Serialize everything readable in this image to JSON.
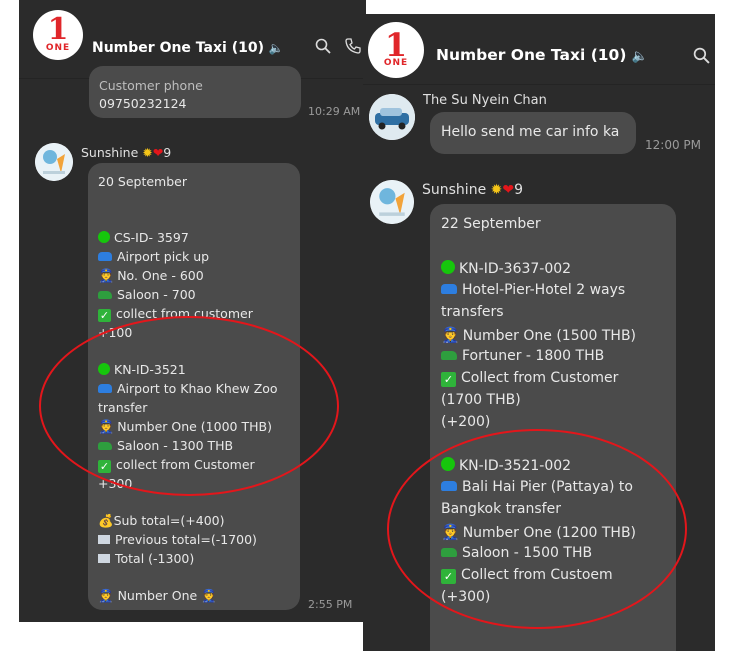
{
  "left": {
    "header": {
      "title": "Number One Taxi",
      "count": "(10)"
    },
    "logo": {
      "numeral": "1",
      "word": "ONE"
    },
    "prev_msg": {
      "lines": [
        "Customer phone",
        "09750232124"
      ],
      "time": "10:29 AM"
    },
    "sender": {
      "name": "Sunshine",
      "suffix": "9"
    },
    "msg": {
      "date": "20 September",
      "l1": "CS-ID- 3597",
      "l2": "Airport pick up",
      "l3": "No. One - 600",
      "l4": "Saloon - 700",
      "l5": "collect from customer",
      "l6": "+100",
      "l7": "KN-ID-3521",
      "l8": "Airport to Khao Khew Zoo",
      "l9": "transfer",
      "l10": "Number One (1000 THB)",
      "l11": "Saloon - 1300 THB",
      "l12": "collect from Customer",
      "l13": "+300",
      "l14": "Sub total=(+400)",
      "l15": "Previous total=(-1700)",
      "l16": "Total (-1300)",
      "l17": "Number One",
      "time": "2:55 PM"
    }
  },
  "right": {
    "header": {
      "title": "Number One Taxi",
      "count": "(10)"
    },
    "logo": {
      "numeral": "1",
      "word": "ONE"
    },
    "prev_sender": "The Su Nyein Chan",
    "prev_msg": {
      "text": "Hello send me car info ka",
      "time": "12:00 PM"
    },
    "sender": {
      "name": "Sunshine",
      "suffix": "9"
    },
    "msg": {
      "date": "22 September",
      "l1": "KN-ID-3637-002",
      "l2": "Hotel-Pier-Hotel 2 ways",
      "l3": "transfers",
      "l4": "Number One (1500 THB)",
      "l5": "Fortuner - 1800 THB",
      "l6": "Collect from Customer",
      "l7": "(1700 THB)",
      "l8": "(+200)",
      "l9": "KN-ID-3521-002",
      "l10": "Bali Hai Pier (Pattaya) to",
      "l11": "Bangkok transfer",
      "l12": "Number One (1200 THB)",
      "l13": "Saloon - 1500 THB",
      "l14": "Collect from Custoem",
      "l15": "(+300)"
    }
  },
  "colors": {
    "bg": "#2b2b2b",
    "bubble": "#4b4b4b",
    "highlight": "#e3161b",
    "logo_red": "#e0262a"
  },
  "icons": [
    "search-icon",
    "phone-icon",
    "speaker-icon",
    "green-circle-icon",
    "car-icon",
    "police-officer-icon",
    "suv-icon",
    "check-mark-icon",
    "money-bag-icon",
    "receipt-icon",
    "sun-icon",
    "heart-icon"
  ]
}
